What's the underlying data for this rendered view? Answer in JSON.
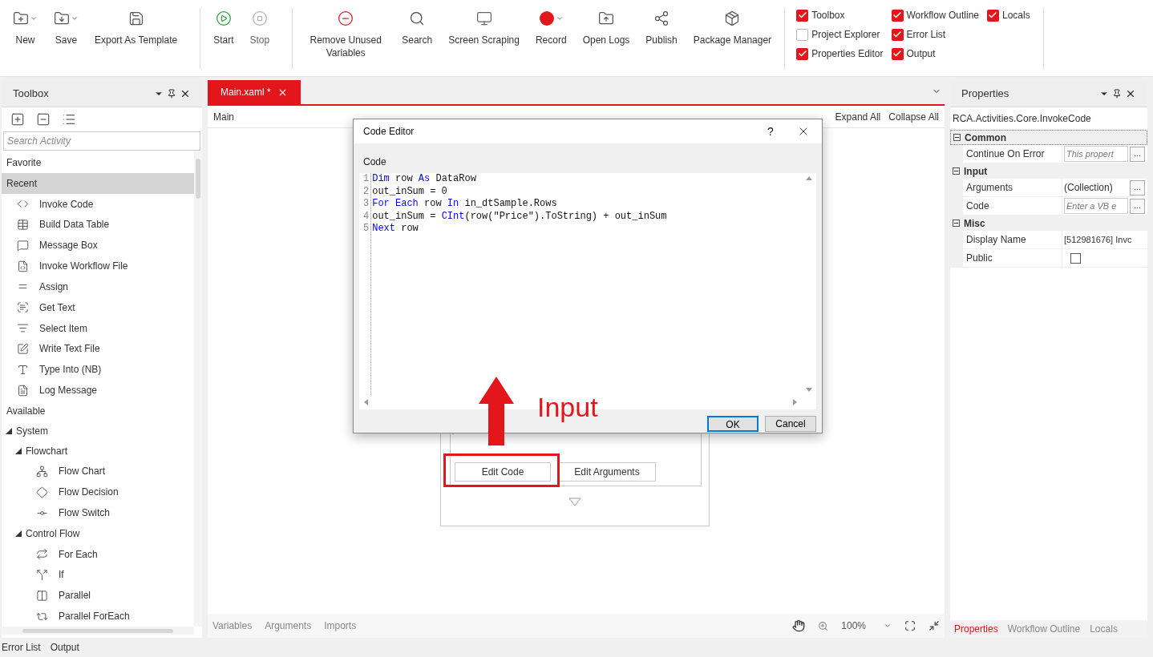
{
  "toolbar": {
    "groups": [
      {
        "items": [
          {
            "label": "New",
            "dropdown": true
          },
          {
            "label": "Save",
            "dropdown": true
          },
          {
            "label": "Export As Template",
            "dropdown": false
          }
        ]
      },
      {
        "items": [
          {
            "label": "Start",
            "dropdown": false,
            "disabled": false
          },
          {
            "label": "Stop",
            "dropdown": false,
            "disabled": true
          }
        ]
      },
      {
        "items": [
          {
            "label": "Remove Unused Variables",
            "dropdown": false
          },
          {
            "label": "Search",
            "dropdown": false
          },
          {
            "label": "Screen Scraping",
            "dropdown": false
          },
          {
            "label": "Record",
            "dropdown": true
          },
          {
            "label": "Open Logs",
            "dropdown": false
          },
          {
            "label": "Publish",
            "dropdown": false
          },
          {
            "label": "Package Manager",
            "dropdown": false
          }
        ]
      }
    ],
    "view_options": [
      {
        "options": [
          {
            "label": "Toolbox",
            "checked": true
          },
          {
            "label": "Project Explorer",
            "checked": false
          },
          {
            "label": "Properties Editor",
            "checked": true
          }
        ]
      },
      {
        "options": [
          {
            "label": "Workflow Outline",
            "checked": true
          },
          {
            "label": "Error List",
            "checked": true
          },
          {
            "label": "Output",
            "checked": true
          }
        ]
      },
      {
        "options": [
          {
            "label": "Locals",
            "checked": true
          }
        ]
      }
    ]
  },
  "toolbox": {
    "title": "Toolbox",
    "search": {
      "placeholder": "Search Activity"
    },
    "sections": [
      {
        "label": "Favorite",
        "selected": false
      },
      {
        "label": "Recent",
        "selected": true,
        "items": [
          "Invoke Code",
          "Build Data Table",
          "Message Box",
          "Invoke Workflow File",
          "Assign",
          "Get Text",
          "Select Item",
          "Write Text File",
          "Type Into (NB)",
          "Log Message"
        ]
      },
      {
        "label": "Available",
        "selected": false,
        "children": [
          {
            "label": "System",
            "expanded": true,
            "children": [
              {
                "label": "Flowchart",
                "expanded": true,
                "items": [
                  "Flow Chart",
                  "Flow Decision",
                  "Flow Switch"
                ]
              },
              {
                "label": "Control Flow",
                "expanded": true,
                "items": [
                  "For Each",
                  "If",
                  "Parallel",
                  "Parallel ForEach"
                ]
              }
            ]
          }
        ]
      }
    ]
  },
  "document": {
    "tab": {
      "label": "Main.xaml *",
      "selected": true
    },
    "breadcrumb": "Main",
    "expand_all": "Expand All",
    "collapse_all": "Collapse All",
    "activity": {
      "buttons": [
        "Edit Code",
        "Edit Arguments"
      ]
    },
    "bottom_tabs": [
      "Variables",
      "Arguments",
      "Imports"
    ],
    "zoom": "100%"
  },
  "annotation": {
    "label": "Input"
  },
  "code_editor": {
    "title": "Code Editor",
    "help": "?",
    "section_label": "Code",
    "lines": [
      {
        "number": "1",
        "tokens": [
          {
            "text": "Dim",
            "kind": "keyword"
          },
          {
            "text": " row ",
            "kind": "plain"
          },
          {
            "text": "As",
            "kind": "keyword"
          },
          {
            "text": " DataRow",
            "kind": "plain"
          }
        ]
      },
      {
        "number": "2",
        "tokens": [
          {
            "text": "out_inSum = 0",
            "kind": "plain"
          }
        ]
      },
      {
        "number": "3",
        "tokens": [
          {
            "text": "For Each",
            "kind": "keyword"
          },
          {
            "text": " row ",
            "kind": "plain"
          },
          {
            "text": "In",
            "kind": "keyword"
          },
          {
            "text": " in_dtSample.Rows",
            "kind": "plain"
          }
        ]
      },
      {
        "number": "4",
        "tokens": [
          {
            "text": "out_inSum = ",
            "kind": "plain"
          },
          {
            "text": "CInt",
            "kind": "keyword"
          },
          {
            "text": "(row(\"Price\").ToString) + out_inSum",
            "kind": "plain"
          }
        ]
      },
      {
        "number": "5",
        "tokens": [
          {
            "text": "Next",
            "kind": "keyword"
          },
          {
            "text": " row",
            "kind": "plain"
          }
        ]
      }
    ],
    "buttons": [
      {
        "label": "OK",
        "default": true
      },
      {
        "label": "Cancel",
        "default": false
      }
    ]
  },
  "properties": {
    "title": "Properties",
    "type_name": "RCA.Activities.Core.InvokeCode",
    "categories": [
      {
        "label": "Common",
        "expanded": true,
        "rows": [
          {
            "name": "Continue On Error",
            "kind": "input",
            "placeholder": "This propert",
            "button": "..."
          }
        ]
      },
      {
        "label": "Input",
        "expanded": true,
        "rows": [
          {
            "name": "Arguments",
            "kind": "collection",
            "value": "(Collection)",
            "button": "..."
          },
          {
            "name": "Code",
            "kind": "input",
            "placeholder": "Enter a VB e",
            "button": "..."
          }
        ]
      },
      {
        "label": "Misc",
        "expanded": true,
        "rows": [
          {
            "name": "Display Name",
            "kind": "text",
            "value": "[512981676] Invc"
          },
          {
            "name": "Public",
            "kind": "checkbox",
            "checked": false
          }
        ]
      }
    ],
    "tabs": [
      {
        "label": "Properties",
        "selected": true
      },
      {
        "label": "Workflow Outline",
        "selected": false
      },
      {
        "label": "Locals",
        "selected": false
      }
    ]
  },
  "bottom_panel": {
    "tabs": [
      "Error List",
      "Output"
    ]
  }
}
